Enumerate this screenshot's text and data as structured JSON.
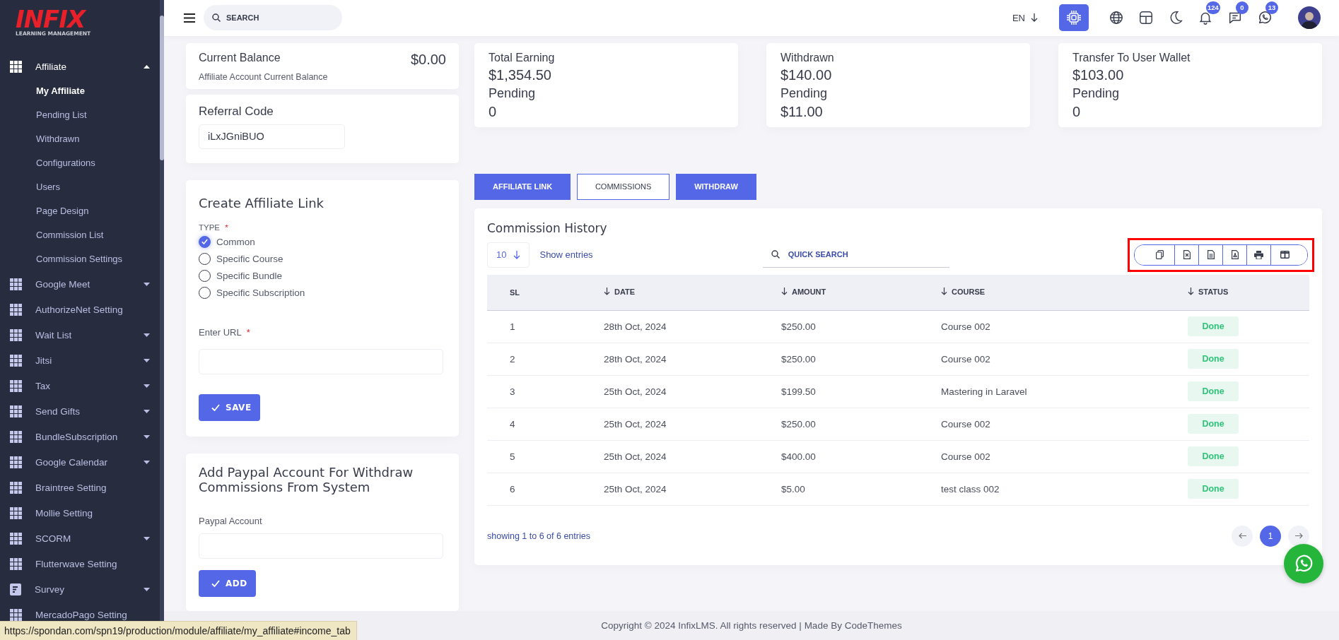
{
  "logo": {
    "brand": "INFIX",
    "tagline": "LEARNING MANAGEMENT"
  },
  "sidebar": {
    "items": [
      {
        "label": "Affiliate",
        "kind": "grid",
        "expanded": true,
        "children": [
          {
            "label": "My Affiliate",
            "selected": true
          },
          {
            "label": "Pending List",
            "selected": false
          },
          {
            "label": "Withdrawn",
            "selected": false
          },
          {
            "label": "Configurations",
            "selected": false
          },
          {
            "label": "Users",
            "selected": false
          },
          {
            "label": "Page Design",
            "selected": false
          },
          {
            "label": "Commission List",
            "selected": false
          },
          {
            "label": "Commission Settings",
            "selected": false
          }
        ]
      },
      {
        "label": "Google Meet",
        "kind": "grid",
        "expanded": false
      },
      {
        "label": "AuthorizeNet Setting",
        "kind": "grid"
      },
      {
        "label": "Wait List",
        "kind": "grid",
        "expanded": false
      },
      {
        "label": "Jitsi",
        "kind": "grid",
        "expanded": false
      },
      {
        "label": "Tax",
        "kind": "grid",
        "expanded": false
      },
      {
        "label": "Send Gifts",
        "kind": "grid",
        "expanded": false
      },
      {
        "label": "BundleSubscription",
        "kind": "grid",
        "expanded": false
      },
      {
        "label": "Google Calendar",
        "kind": "grid",
        "expanded": false
      },
      {
        "label": "Braintree Setting",
        "kind": "grid"
      },
      {
        "label": "Mollie Setting",
        "kind": "grid"
      },
      {
        "label": "SCORM",
        "kind": "grid",
        "expanded": false
      },
      {
        "label": "Flutterwave Setting",
        "kind": "grid"
      },
      {
        "label": "Survey",
        "kind": "doc",
        "expanded": false
      },
      {
        "label": "MercadoPago Setting",
        "kind": "grid"
      }
    ]
  },
  "header": {
    "search": {
      "placeholder": "SEARCH"
    },
    "language": "EN",
    "notifications": [
      {
        "kind": "bell",
        "count": "124"
      },
      {
        "kind": "chat",
        "count": "0"
      },
      {
        "kind": "phone",
        "count": "13"
      }
    ]
  },
  "balance_card": {
    "title": "Current Balance",
    "amount": "$0.00",
    "subtitle": "Affiliate Account Current Balance"
  },
  "referral": {
    "label": "Referral Code",
    "value": "iLxJGniBUO"
  },
  "stats": [
    {
      "title": "Total Earning",
      "amount": "$1,354.50",
      "pending_label": "Pending",
      "pending": "0"
    },
    {
      "title": "Withdrawn",
      "amount": "$140.00",
      "pending_label": "Pending",
      "pending": "$11.00"
    },
    {
      "title": "Transfer To User Wallet",
      "amount": "$103.00",
      "pending_label": "Pending",
      "pending": "0"
    }
  ],
  "create_link": {
    "title": "Create Affiliate Link",
    "type_label": {
      "label": "TYPE",
      "mark": "*"
    },
    "options": [
      {
        "label": "Common",
        "selected": true
      },
      {
        "label": "Specific Course",
        "selected": false
      },
      {
        "label": "Specific Bundle",
        "selected": false
      },
      {
        "label": "Specific Subscription",
        "selected": false
      }
    ],
    "url_label": {
      "label": "Enter URL",
      "mark": "*"
    },
    "save": "SAVE"
  },
  "paypal": {
    "title": "Add Paypal Account For Withdraw Commissions From System",
    "label": "Paypal Account",
    "add": "ADD"
  },
  "tabs": [
    {
      "label": "AFFILIATE LINK",
      "selected": false
    },
    {
      "label": "COMMISSIONS",
      "selected": true
    },
    {
      "label": "WITHDRAW",
      "selected": false
    }
  ],
  "table": {
    "title": "Commission History",
    "page_size": "10",
    "show_entries": "Show entries",
    "search": {
      "placeholder": "QUICK SEARCH"
    },
    "columns": [
      {
        "label": "SL",
        "sortable": false
      },
      {
        "label": "DATE",
        "sortable": true
      },
      {
        "label": "AMOUNT",
        "sortable": true
      },
      {
        "label": "COURSE",
        "sortable": true
      },
      {
        "label": "STATUS",
        "sortable": true
      }
    ],
    "rows": [
      [
        "1",
        "28th Oct, 2024",
        "$250.00",
        "Course 002",
        "Done"
      ],
      [
        "2",
        "28th Oct, 2024",
        "$250.00",
        "Course 002",
        "Done"
      ],
      [
        "3",
        "25th Oct, 2024",
        "$199.50",
        "Mastering in Laravel",
        "Done"
      ],
      [
        "4",
        "25th Oct, 2024",
        "$250.00",
        "Course 002",
        "Done"
      ],
      [
        "5",
        "25th Oct, 2024",
        "$400.00",
        "Course 002",
        "Done"
      ],
      [
        "6",
        "25th Oct, 2024",
        "$5.00",
        "test class 002",
        "Done"
      ]
    ],
    "summary": "showing 1 to 6 of 6 entries",
    "pages": [
      {
        "label": "1",
        "selected": true
      }
    ]
  },
  "footer": "Copyright © 2024 InfixLMS. All rights reserved | Made By CodeThemes",
  "status_url": "https://spondan.com/spn19/production/module/affiliate/my_affiliate#income_tab"
}
